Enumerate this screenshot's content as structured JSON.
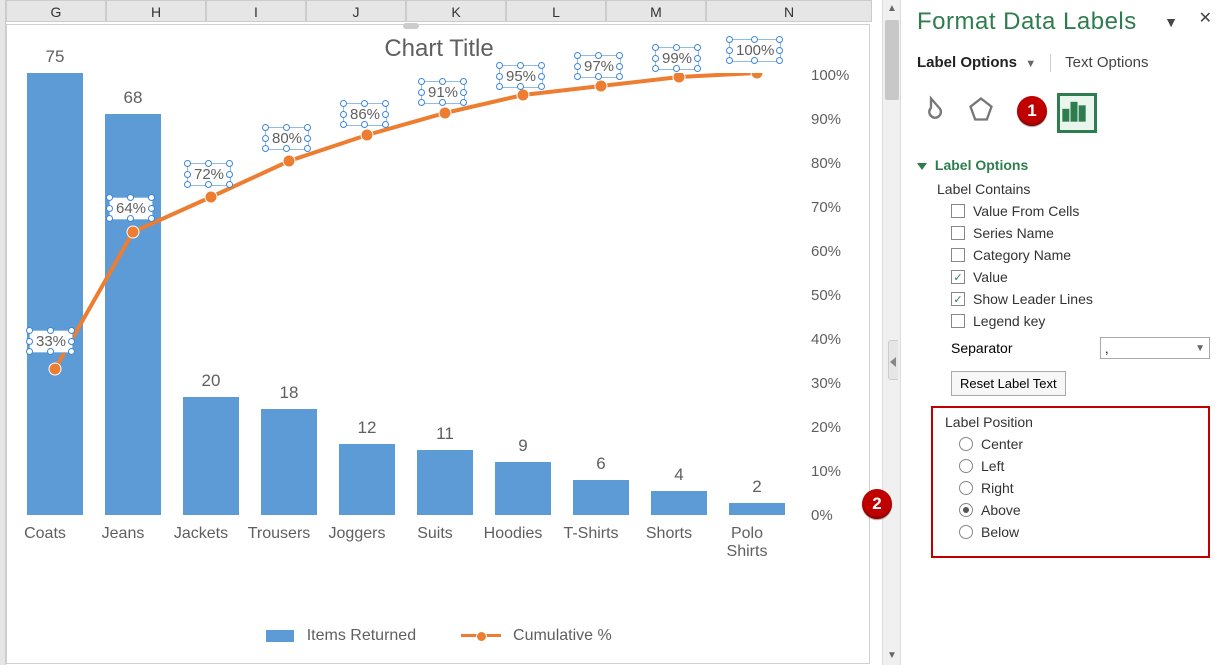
{
  "columns": [
    "G",
    "H",
    "I",
    "J",
    "K",
    "L",
    "M",
    "N"
  ],
  "chart_data": {
    "type": "bar",
    "title": "Chart Title",
    "categories": [
      "Coats",
      "Jeans",
      "Jackets",
      "Trousers",
      "Joggers",
      "Suits",
      "Hoodies",
      "T-Shirts",
      "Shorts",
      "Polo Shirts"
    ],
    "series": [
      {
        "name": "Items Returned",
        "type": "bar",
        "axis": "primary",
        "values": [
          75,
          68,
          20,
          18,
          12,
          11,
          9,
          6,
          4,
          2
        ]
      },
      {
        "name": "Cumulative %",
        "type": "line",
        "axis": "secondary",
        "values": [
          33,
          64,
          72,
          80,
          86,
          91,
          95,
          97,
          99,
          100
        ],
        "labels": [
          "33%",
          "64%",
          "72%",
          "80%",
          "86%",
          "91%",
          "95%",
          "97%",
          "99%",
          "100%"
        ]
      }
    ],
    "secondary_axis": {
      "ticks": [
        0,
        10,
        20,
        30,
        40,
        50,
        60,
        70,
        80,
        90,
        100
      ],
      "tick_labels": [
        "0%",
        "10%",
        "20%",
        "30%",
        "40%",
        "50%",
        "60%",
        "70%",
        "80%",
        "90%",
        "100%"
      ]
    }
  },
  "legend": {
    "items_returned": "Items Returned",
    "cumulative": "Cumulative %"
  },
  "pane": {
    "title": "Format Data Labels",
    "tab_label_options": "Label Options",
    "tab_text_options": "Text Options",
    "section_label_options": "Label Options",
    "label_contains": "Label Contains",
    "value_from_cells": "Value From Cells",
    "series_name": "Series Name",
    "category_name": "Category Name",
    "value": "Value",
    "show_leader_lines": "Show Leader Lines",
    "legend_key": "Legend key",
    "separator": "Separator",
    "separator_value": ",",
    "reset_label_text": "Reset Label Text",
    "label_position": "Label Position",
    "center": "Center",
    "left": "Left",
    "right": "Right",
    "above": "Above",
    "below": "Below",
    "badge1": "1",
    "badge2": "2"
  }
}
